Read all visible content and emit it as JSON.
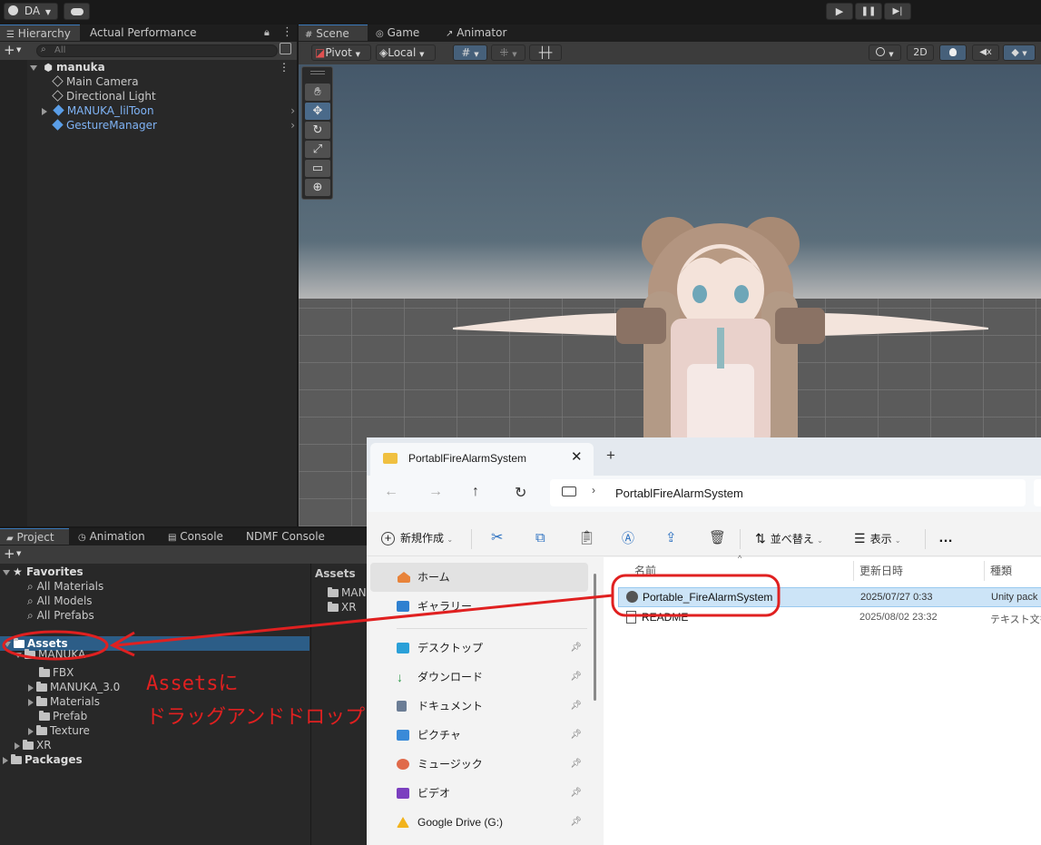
{
  "toolbar": {
    "account": "DA",
    "play_icon": "play-icon",
    "pause_icon": "pause-icon",
    "step_icon": "step-icon",
    "cloud_icon": "cloud-icon"
  },
  "hierarchy": {
    "tabs": [
      "Hierarchy",
      "Actual Performance"
    ],
    "search_placeholder": "All",
    "scene": "manuka",
    "items": [
      {
        "label": "Main Camera",
        "color": "#c8c8c8"
      },
      {
        "label": "Directional Light",
        "color": "#c8c8c8"
      },
      {
        "label": "MANUKA_lilToon",
        "color": "#7fb3f5"
      },
      {
        "label": "GestureManager",
        "color": "#7fb3f5"
      }
    ]
  },
  "scene_view": {
    "tabs": [
      "Scene",
      "Game",
      "Animator"
    ],
    "pivot": "Pivot",
    "local": "Local",
    "mode_2d": "2D",
    "sky_color": "#4b5d6a",
    "ground_color": "#5a5a5a"
  },
  "project": {
    "tabs": [
      "Project",
      "Animation",
      "Console",
      "NDMF Console"
    ],
    "favorites_label": "Favorites",
    "favorites": [
      "All Materials",
      "All Models",
      "All Prefabs"
    ],
    "assets_label": "Assets",
    "assets_children": [
      {
        "label": "MANUKA",
        "indent": 1
      },
      {
        "label": "FBX",
        "indent": 2
      },
      {
        "label": "MANUKA_3.0",
        "indent": 2
      },
      {
        "label": "Materials",
        "indent": 2
      },
      {
        "label": "Prefab",
        "indent": 2
      },
      {
        "label": "Texture",
        "indent": 2
      },
      {
        "label": "XR",
        "indent": 1
      }
    ],
    "packages_label": "Packages",
    "right_header": "Assets",
    "right_items": [
      "MAN",
      "XR"
    ]
  },
  "annotation": {
    "line1": "Assetsに",
    "line2": "ドラッグアンドドロップ",
    "color": "#e02020"
  },
  "explorer": {
    "tab_title": "PortablFireAlarmSystem",
    "breadcrumb": "PortablFireAlarmSystem",
    "new_label": "新規作成",
    "sort_label": "並べ替え",
    "view_label": "表示",
    "more_label": "…",
    "nav": [
      {
        "label": "ホーム",
        "color": "#e8833a"
      },
      {
        "label": "ギャラリー",
        "color": "#2f80d0"
      },
      {
        "label": "デスクトップ",
        "color": "#2aa0d8"
      },
      {
        "label": "ダウンロード",
        "color": "#2e9a48"
      },
      {
        "label": "ドキュメント",
        "color": "#6b7d95"
      },
      {
        "label": "ピクチャ",
        "color": "#3a8ad8"
      },
      {
        "label": "ミュージック",
        "color": "#e06a4a"
      },
      {
        "label": "ビデオ",
        "color": "#7b3fbf"
      },
      {
        "label": "Google Drive (G:)",
        "color": "#f2b31c"
      }
    ],
    "columns": [
      "名前",
      "更新日時",
      "種類"
    ],
    "files": [
      {
        "name": "Portable_FireAlarmSystem",
        "date": "2025/07/27 0:33",
        "type": "Unity pack"
      },
      {
        "name": "README",
        "date": "2025/08/02 23:32",
        "type": "テキスト文書"
      }
    ]
  }
}
